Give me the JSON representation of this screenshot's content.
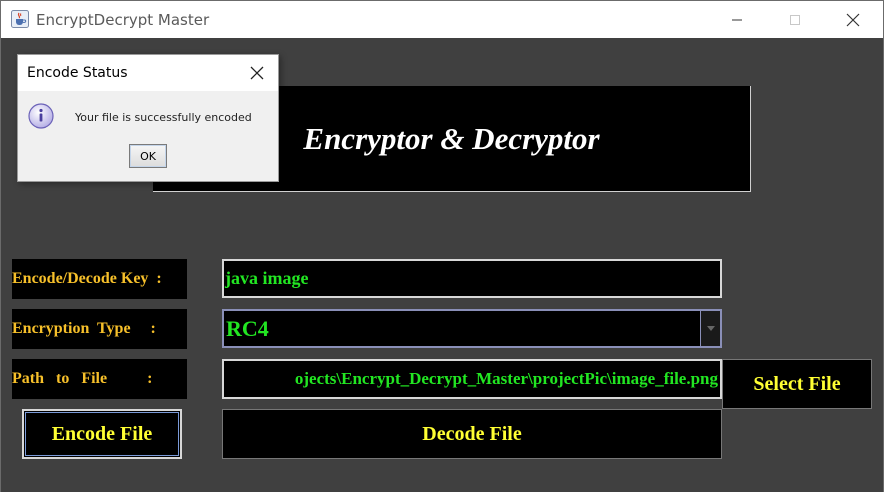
{
  "window": {
    "title": "EncryptDecrypt Master",
    "icon": "java-cup-icon",
    "controls": [
      "minimize-icon",
      "maximize-icon",
      "close-icon"
    ]
  },
  "banner": {
    "title": "Encryptor & Decryptor"
  },
  "form": {
    "key_label": "Encode/Decode Key  :",
    "key_value": "java image",
    "type_label": "Encryption  Type     :",
    "type_value": "RC4",
    "path_label": "Path   to   File          :",
    "path_value": "ojects\\Encrypt_Decrypt_Master\\projectPic\\image_file.png"
  },
  "buttons": {
    "select_file": "Select File",
    "encode_file": "Encode File",
    "decode_file": "Decode File"
  },
  "dialog": {
    "title": "Encode Status",
    "message": "Your file is successfully encoded",
    "ok_label": "OK",
    "icon": "info-icon"
  },
  "colors": {
    "background": "#404040",
    "label_text": "#f7c02a",
    "field_text": "#22e622",
    "button_text": "#ffff33",
    "banner_text": "#ffffff"
  }
}
